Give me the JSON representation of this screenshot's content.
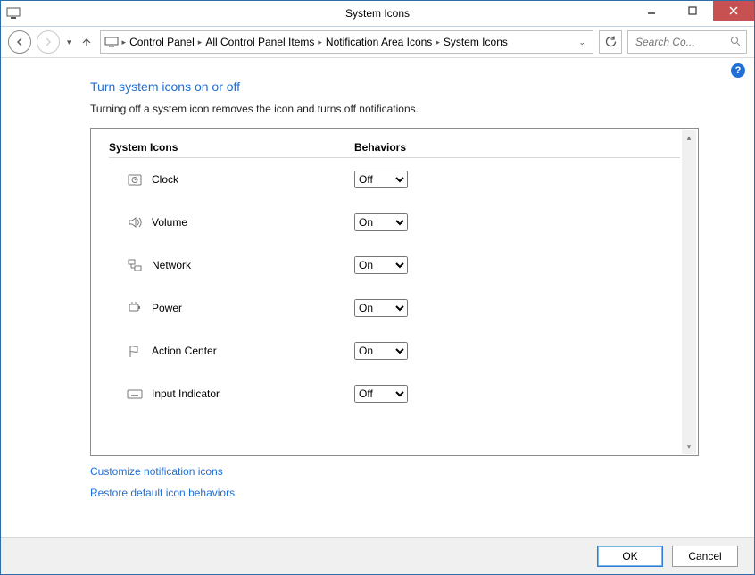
{
  "window": {
    "title": "System Icons"
  },
  "breadcrumbs": {
    "items": [
      "Control Panel",
      "All Control Panel Items",
      "Notification Area Icons",
      "System Icons"
    ]
  },
  "search": {
    "placeholder": "Search Co..."
  },
  "page": {
    "heading": "Turn system icons on or off",
    "subtitle": "Turning off a system icon removes the icon and turns off notifications."
  },
  "columns": {
    "c1": "System Icons",
    "c2": "Behaviors"
  },
  "options": {
    "on": "On",
    "off": "Off"
  },
  "rows": [
    {
      "label": "Clock",
      "value": "Off"
    },
    {
      "label": "Volume",
      "value": "On"
    },
    {
      "label": "Network",
      "value": "On"
    },
    {
      "label": "Power",
      "value": "On"
    },
    {
      "label": "Action Center",
      "value": "On"
    },
    {
      "label": "Input Indicator",
      "value": "Off"
    }
  ],
  "links": {
    "customize": "Customize notification icons",
    "restore": "Restore default icon behaviors"
  },
  "buttons": {
    "ok": "OK",
    "cancel": "Cancel"
  }
}
